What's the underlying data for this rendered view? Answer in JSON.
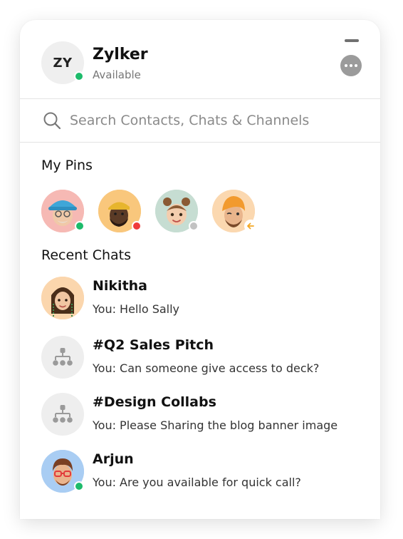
{
  "user": {
    "initials": "ZY",
    "name": "Zylker",
    "status": "Available"
  },
  "search": {
    "placeholder": "Search Contacts, Chats & Channels"
  },
  "pins": {
    "title": "My Pins",
    "items": [
      {
        "status": "online",
        "status_color": "#1dbb6b",
        "bg": "#f6b9b4"
      },
      {
        "status": "busy",
        "status_color": "#ef3b3b",
        "bg": "#f9c77c"
      },
      {
        "status": "offline",
        "status_color": "#c2c2c2",
        "bg": "#c6ddd2"
      },
      {
        "status": "away-arrow",
        "status_color": "#f2a623",
        "bg": "#fbd8b0"
      }
    ]
  },
  "recent": {
    "title": "Recent Chats",
    "chats": [
      {
        "name": "Nikitha",
        "preview": "You:  Hello Sally",
        "type": "contact"
      },
      {
        "name": "#Q2 Sales Pitch",
        "preview": "You:  Can someone give access to deck?",
        "type": "channel"
      },
      {
        "name": "#Design Collabs",
        "preview": "You:  Please Sharing the blog banner image",
        "type": "channel"
      },
      {
        "name": "Arjun",
        "preview": "You:  Are you available for quick call?",
        "type": "contact"
      }
    ]
  },
  "colors": {
    "online": "#1dbb6b",
    "busy": "#ef3b3b",
    "away": "#f2a623"
  },
  "icons": [
    "search-icon",
    "minimize-icon",
    "more-options-icon",
    "channel-icon",
    "arrow-left-icon"
  ]
}
